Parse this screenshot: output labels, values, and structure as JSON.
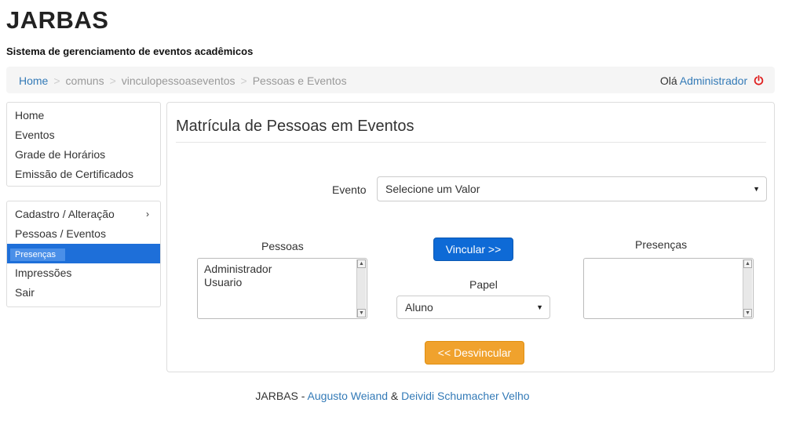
{
  "header": {
    "title": "JARBAS",
    "subtitle": "Sistema de gerenciamento de eventos acadêmicos"
  },
  "breadcrumb": {
    "items": [
      "Home",
      "comuns",
      "vinculopessoaseventos",
      "Pessoas e Eventos"
    ],
    "separator": ">"
  },
  "user": {
    "greeting": "Olá",
    "name": "Administrador",
    "logout_icon": "power-icon"
  },
  "menu": {
    "primary": [
      "Home",
      "Eventos",
      "Grade de Horários",
      "Emissão de Certificados"
    ],
    "secondary": [
      {
        "label": "Cadastro / Alteração",
        "chevron": "›"
      },
      {
        "label": "Pessoas / Eventos"
      },
      {
        "label": "Presenças",
        "active": true
      },
      {
        "label": "Impressões"
      },
      {
        "label": "Sair"
      }
    ]
  },
  "main": {
    "title": "Matrícula de Pessoas em Eventos",
    "evento_label": "Evento",
    "evento_value": "Selecione um Valor",
    "pessoas_label": "Pessoas",
    "pessoas": [
      "Administrador",
      "Usuario"
    ],
    "vincular_button": "Vincular >>",
    "papel_label": "Papel",
    "papel_value": "Aluno",
    "presencas_label": "Presenças",
    "presencas": [],
    "desvincular_button": "<< Desvincular"
  },
  "footer": {
    "prefix": "JARBAS - ",
    "author1": "Augusto Weiand",
    "amp": " & ",
    "author2": "Deividi Schumacher Velho"
  },
  "colors": {
    "primary_button": "#0e6ad6",
    "warning_button": "#f0a22d",
    "active_menu": "#1e6fd9",
    "link": "#337ab7",
    "logout_icon": "#e02020"
  }
}
